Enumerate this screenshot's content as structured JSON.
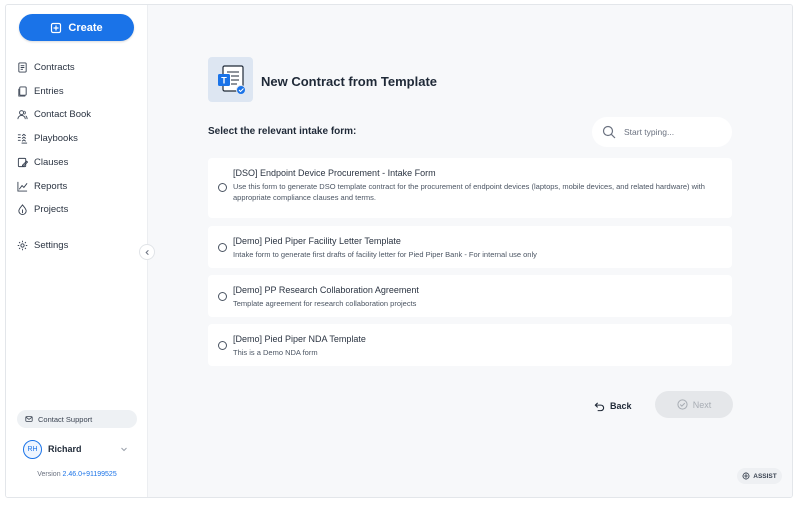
{
  "sidebar": {
    "create_label": "Create",
    "items": [
      {
        "label": "Contracts",
        "icon": "contract-icon"
      },
      {
        "label": "Entries",
        "icon": "entries-icon"
      },
      {
        "label": "Contact Book",
        "icon": "contacts-icon"
      },
      {
        "label": "Playbooks",
        "icon": "playbooks-icon"
      },
      {
        "label": "Clauses",
        "icon": "clauses-icon"
      },
      {
        "label": "Reports",
        "icon": "reports-icon"
      },
      {
        "label": "Projects",
        "icon": "projects-icon"
      },
      {
        "label": "Settings",
        "icon": "gear-icon"
      }
    ],
    "support_label": "Contact Support",
    "user": {
      "initials": "RH",
      "name": "Richard"
    },
    "version_prefix": "Version ",
    "version_number": "2.46.0+91199525"
  },
  "main": {
    "page_title": "New Contract from Template",
    "section_label": "Select the relevant intake form:",
    "search_placeholder": "Start typing...",
    "forms": [
      {
        "title": "[DSO] Endpoint Device Procurement - Intake Form",
        "description": "Use this form to generate DSO template contract for the procurement of endpoint devices (laptops, mobile devices, and related hardware) with appropriate compliance clauses and terms."
      },
      {
        "title": "[Demo] Pied Piper Facility Letter Template",
        "description": "Intake form to generate first drafts of facility letter for Pied Piper Bank - For internal use only"
      },
      {
        "title": "[Demo] PP Research Collaboration Agreement",
        "description": "Template agreement for research collaboration projects"
      },
      {
        "title": "[Demo] Pied Piper NDA Template",
        "description": "This is a Demo NDA form"
      }
    ],
    "back_label": "Back",
    "next_label": "Next",
    "assist_label": "ASSIST"
  },
  "colors": {
    "accent": "#1a73e8",
    "background": "#f7f8fa",
    "disabled": "#e5e7ea"
  }
}
